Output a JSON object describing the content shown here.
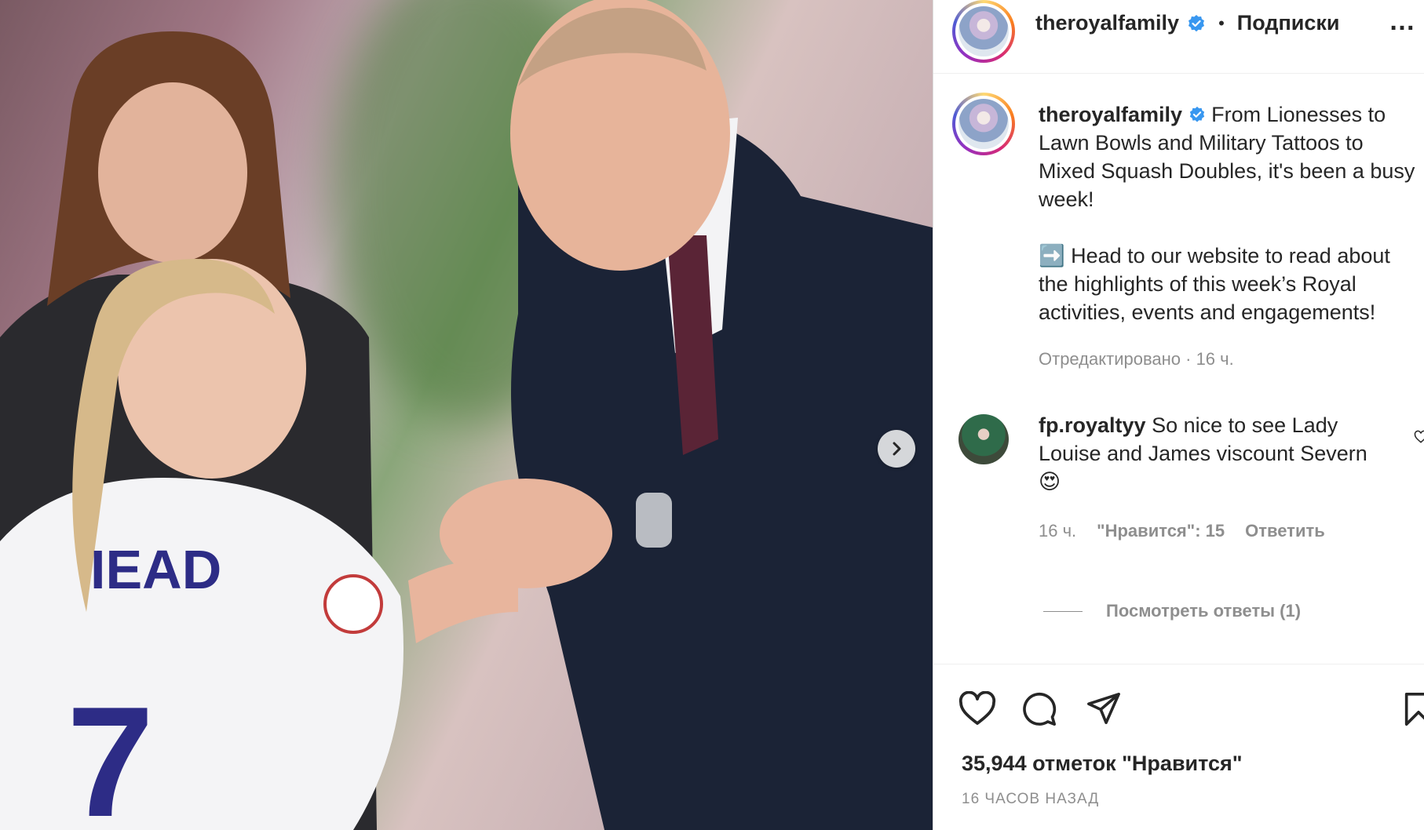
{
  "post": {
    "author": "theroyalfamily",
    "follow_label": "Подписки",
    "more_label": "…",
    "caption_p1": "From Lionesses to Lawn Bowls and Military Tattoos to Mixed Squash Doubles, it's been a busy week!",
    "caption_p2": "➡️ Head to our website to read about the highlights of this week’s Royal activities, events and engagements!",
    "caption_meta": "Отредактировано · 16 ч."
  },
  "comment": {
    "author": "fp.royaltyy",
    "text": "So nice to see Lady Louise and James viscount Severn",
    "emoji": "😍",
    "time": "16 ч.",
    "likes": "\"Нравится\": 15",
    "reply": "Ответить",
    "view_replies": "Посмотреть ответы (1)"
  },
  "footer": {
    "likes_count": "35,944 отметок \"Нравится\"",
    "time_ago": "16 ЧАСОВ НАЗАД"
  },
  "icons": {
    "like": "heart-icon",
    "comment": "comment-icon",
    "share": "share-icon",
    "save": "bookmark-icon",
    "next": "chevron-right-icon",
    "verified": "verified-badge-icon"
  },
  "colors": {
    "verified_blue": "#3897f0",
    "text": "#262626",
    "muted": "#8e8e8e"
  }
}
